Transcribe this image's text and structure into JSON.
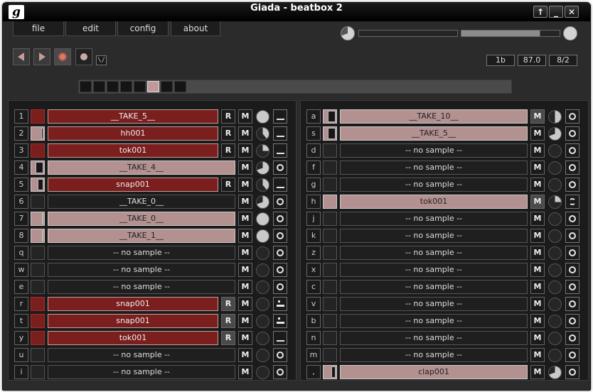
{
  "window": {
    "title": "Giada - beatbox 2",
    "logo": "g",
    "buttons": {
      "up": "↑",
      "minimize": "_",
      "close": "✕"
    }
  },
  "menu": {
    "file": "file",
    "edit": "edit",
    "config": "config",
    "about": "about"
  },
  "transport": {
    "metronome": "\\/"
  },
  "info": {
    "beats": "1b",
    "bpm": "87.0",
    "meter": "8/2"
  },
  "beat_meter": {
    "total": 8,
    "active": 6
  },
  "colors": {
    "red": "#7a1e1e",
    "pink": "#b49191",
    "record": "#e07a5a"
  },
  "channels_left": [
    {
      "key": "1",
      "name": "__TAKE_5__",
      "style": "red",
      "meter": "red",
      "fill": 0,
      "rec": true,
      "rec_on": false,
      "mute_on": false,
      "knob": "full",
      "mode": "bar"
    },
    {
      "key": "2",
      "name": "hh001",
      "style": "red",
      "meter": "pink",
      "fill": 0.2,
      "rec": true,
      "rec_on": false,
      "mute_on": false,
      "knob": "tick",
      "mode": "bar"
    },
    {
      "key": "3",
      "name": "tok001",
      "style": "red",
      "meter": "red",
      "fill": 0,
      "rec": true,
      "rec_on": false,
      "mute_on": false,
      "knob": "quarter",
      "mode": "bar"
    },
    {
      "key": "4",
      "name": "__TAKE_4__",
      "style": "pink",
      "meter": "pink",
      "fill": 0.7,
      "rec": false,
      "rec_on": false,
      "mute_on": false,
      "knob": "three",
      "mode": "ring"
    },
    {
      "key": "5",
      "name": "snap001",
      "style": "red",
      "meter": "pink",
      "fill": 0.5,
      "rec": true,
      "rec_on": false,
      "mute_on": false,
      "knob": "tick",
      "mode": "bar"
    },
    {
      "key": "6",
      "name": "__TAKE_0__",
      "style": "none",
      "meter": "none",
      "fill": 0,
      "rec": false,
      "rec_on": false,
      "mute_on": false,
      "knob": "three",
      "mode": "ring"
    },
    {
      "key": "7",
      "name": "__TAKE_0__",
      "style": "pink",
      "meter": "pink",
      "fill": 0.15,
      "rec": false,
      "rec_on": false,
      "mute_on": false,
      "knob": "full",
      "mode": "ring"
    },
    {
      "key": "8",
      "name": "__TAKE_1__",
      "style": "pink",
      "meter": "pink",
      "fill": 0.15,
      "rec": false,
      "rec_on": false,
      "mute_on": false,
      "knob": "full",
      "mode": "ring"
    },
    {
      "key": "q",
      "name": "-- no sample --",
      "style": "none",
      "meter": "none",
      "fill": 0,
      "rec": false,
      "rec_on": false,
      "mute_on": false,
      "knob": "empty",
      "mode": "ring"
    },
    {
      "key": "w",
      "name": "-- no sample --",
      "style": "none",
      "meter": "none",
      "fill": 0,
      "rec": false,
      "rec_on": false,
      "mute_on": false,
      "knob": "empty",
      "mode": "ring"
    },
    {
      "key": "e",
      "name": "-- no sample --",
      "style": "none",
      "meter": "none",
      "fill": 0,
      "rec": false,
      "rec_on": false,
      "mute_on": false,
      "knob": "empty",
      "mode": "ring"
    },
    {
      "key": "r",
      "name": "snap001",
      "style": "red",
      "meter": "red",
      "fill": 0,
      "rec": true,
      "rec_on": true,
      "mute_on": false,
      "knob": "empty",
      "mode": "dot"
    },
    {
      "key": "t",
      "name": "snap001",
      "style": "red",
      "meter": "red",
      "fill": 0,
      "rec": true,
      "rec_on": true,
      "mute_on": false,
      "knob": "empty",
      "mode": "dot"
    },
    {
      "key": "y",
      "name": "tok001",
      "style": "red",
      "meter": "red",
      "fill": 0,
      "rec": true,
      "rec_on": true,
      "mute_on": false,
      "knob": "empty",
      "mode": "bar"
    },
    {
      "key": "u",
      "name": "-- no sample --",
      "style": "none",
      "meter": "none",
      "fill": 0,
      "rec": false,
      "rec_on": false,
      "mute_on": false,
      "knob": "empty",
      "mode": "ring"
    },
    {
      "key": "i",
      "name": "-- no sample --",
      "style": "none",
      "meter": "none",
      "fill": 0,
      "rec": false,
      "rec_on": false,
      "mute_on": false,
      "knob": "empty",
      "mode": "ring"
    }
  ],
  "channels_right": [
    {
      "key": "a",
      "name": "__TAKE_10__",
      "style": "pink",
      "meter": "pink",
      "fill": 0.7,
      "rec": false,
      "rec_on": false,
      "mute_on": true,
      "knob": "half",
      "mode": "ring"
    },
    {
      "key": "s",
      "name": "__TAKE_5__",
      "style": "pink",
      "meter": "pink",
      "fill": 0.7,
      "rec": false,
      "rec_on": false,
      "mute_on": false,
      "knob": "three",
      "mode": "ring"
    },
    {
      "key": "d",
      "name": "-- no sample --",
      "style": "none",
      "meter": "none",
      "fill": 0,
      "rec": false,
      "rec_on": false,
      "mute_on": false,
      "knob": "empty",
      "mode": "ring"
    },
    {
      "key": "f",
      "name": "-- no sample --",
      "style": "none",
      "meter": "none",
      "fill": 0,
      "rec": false,
      "rec_on": false,
      "mute_on": false,
      "knob": "empty",
      "mode": "ring"
    },
    {
      "key": "g",
      "name": "-- no sample --",
      "style": "none",
      "meter": "none",
      "fill": 0,
      "rec": false,
      "rec_on": false,
      "mute_on": false,
      "knob": "empty",
      "mode": "ring"
    },
    {
      "key": "h",
      "name": "tok001",
      "style": "pink",
      "meter": "pink",
      "fill": 0,
      "rec": false,
      "rec_on": false,
      "mute_on": true,
      "knob": "quarter",
      "mode": "loop"
    },
    {
      "key": "j",
      "name": "-- no sample --",
      "style": "none",
      "meter": "none",
      "fill": 0,
      "rec": false,
      "rec_on": false,
      "mute_on": false,
      "knob": "empty",
      "mode": "ring"
    },
    {
      "key": "k",
      "name": "-- no sample --",
      "style": "none",
      "meter": "none",
      "fill": 0,
      "rec": false,
      "rec_on": false,
      "mute_on": false,
      "knob": "empty",
      "mode": "ring"
    },
    {
      "key": "z",
      "name": "-- no sample --",
      "style": "none",
      "meter": "none",
      "fill": 0,
      "rec": false,
      "rec_on": false,
      "mute_on": false,
      "knob": "empty",
      "mode": "ring"
    },
    {
      "key": "x",
      "name": "-- no sample --",
      "style": "none",
      "meter": "none",
      "fill": 0,
      "rec": false,
      "rec_on": false,
      "mute_on": false,
      "knob": "empty",
      "mode": "ring"
    },
    {
      "key": "c",
      "name": "-- no sample --",
      "style": "none",
      "meter": "none",
      "fill": 0,
      "rec": false,
      "rec_on": false,
      "mute_on": false,
      "knob": "empty",
      "mode": "ring"
    },
    {
      "key": "v",
      "name": "-- no sample --",
      "style": "none",
      "meter": "none",
      "fill": 0,
      "rec": false,
      "rec_on": false,
      "mute_on": false,
      "knob": "empty",
      "mode": "ring"
    },
    {
      "key": "b",
      "name": "-- no sample --",
      "style": "none",
      "meter": "none",
      "fill": 0,
      "rec": false,
      "rec_on": false,
      "mute_on": false,
      "knob": "empty",
      "mode": "ring"
    },
    {
      "key": "n",
      "name": "-- no sample --",
      "style": "none",
      "meter": "none",
      "fill": 0,
      "rec": false,
      "rec_on": false,
      "mute_on": false,
      "knob": "empty",
      "mode": "ring"
    },
    {
      "key": "m",
      "name": "-- no sample --",
      "style": "none",
      "meter": "none",
      "fill": 0,
      "rec": false,
      "rec_on": false,
      "mute_on": false,
      "knob": "empty",
      "mode": "ring"
    },
    {
      "key": ",",
      "name": "clap001",
      "style": "pink",
      "meter": "pink",
      "fill": 0.4,
      "rec": false,
      "rec_on": false,
      "mute_on": false,
      "knob": "three",
      "mode": "ring"
    }
  ],
  "row_labels": {
    "rec": "R",
    "mute": "M"
  }
}
